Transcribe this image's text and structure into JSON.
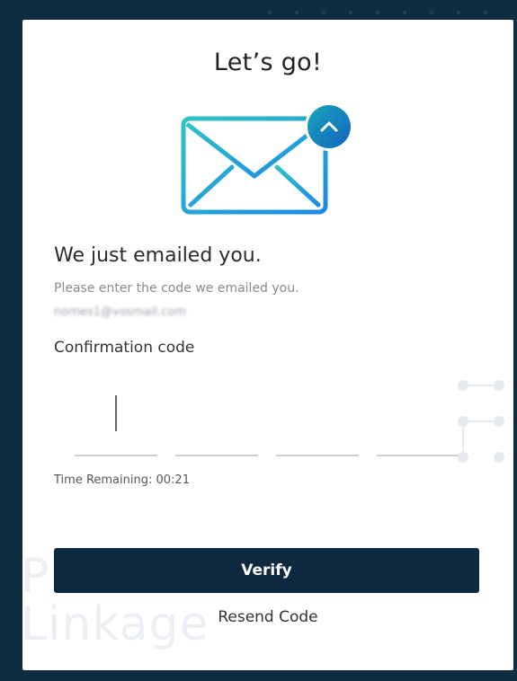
{
  "card": {
    "title": "Let’s go!",
    "heading": "We just emailed you.",
    "subtitle": "Please enter the code we emailed you.",
    "email": "nomes1@vosmail.com",
    "code_label": "Confirmation code",
    "code_digits": [
      "",
      "",
      "",
      ""
    ],
    "timer_label": "Time Remaining:",
    "timer_value": "00:21",
    "verify_label": "Verify",
    "resend_label": "Resend Code"
  },
  "watermark": {
    "line1": "Pharma",
    "line2": "Linkage"
  },
  "colors": {
    "background": "#0d2d40",
    "button": "#0f2a40",
    "envelope_start": "#2ec4c4",
    "envelope_end": "#1e88e5",
    "badge": "#1976d2"
  },
  "icons": {
    "envelope": "envelope-icon",
    "badge": "chevron-up-icon"
  }
}
